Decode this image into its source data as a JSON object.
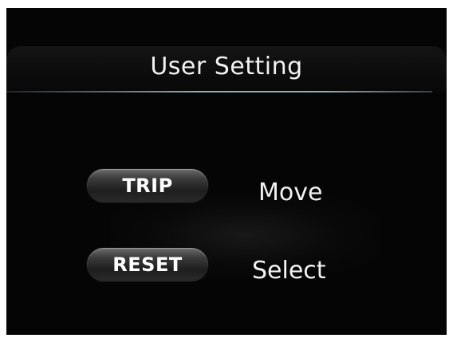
{
  "header": {
    "title": "User Setting"
  },
  "controls": [
    {
      "button_label": "TRIP",
      "action_label": "Move"
    },
    {
      "button_label": "RESET",
      "action_label": "Select"
    }
  ],
  "colors": {
    "screen_background": "#050505",
    "text": "#f2f2f2",
    "divider": "#aac8dc"
  }
}
